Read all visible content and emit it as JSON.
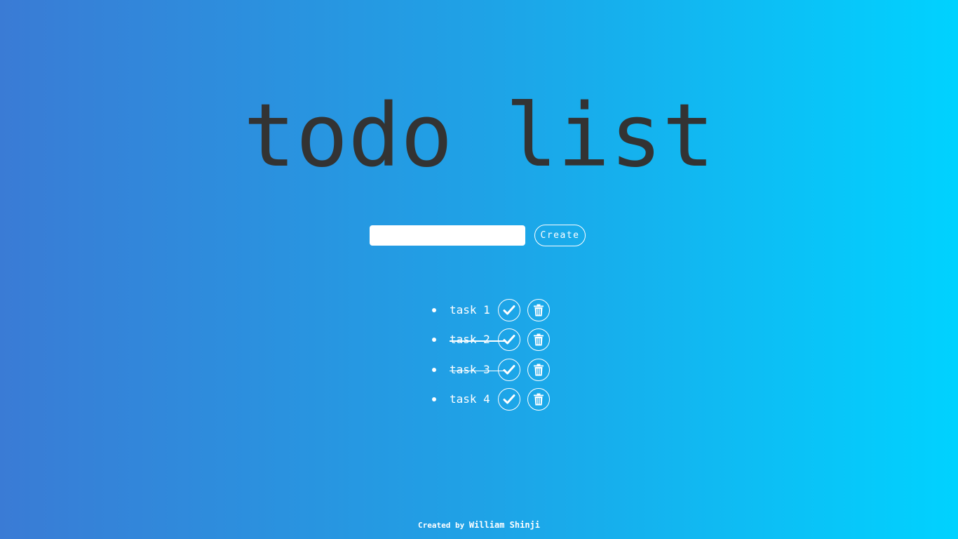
{
  "app": {
    "title": "todo list"
  },
  "form": {
    "input_value": "",
    "input_placeholder": "",
    "create_label": "Create"
  },
  "tasks": [
    {
      "text": "task 1",
      "done": false
    },
    {
      "text": "task 2",
      "done": true
    },
    {
      "text": "task 3",
      "done": true
    },
    {
      "text": "task 4",
      "done": false
    }
  ],
  "icons": {
    "complete": "check-icon",
    "delete": "trash-icon"
  },
  "footer": {
    "prefix": "Created by",
    "author": "William Shinji"
  },
  "colors": {
    "gradient_start": "#3a7bd5",
    "gradient_end": "#00d2ff",
    "title": "#333333",
    "foreground": "#ffffff"
  }
}
